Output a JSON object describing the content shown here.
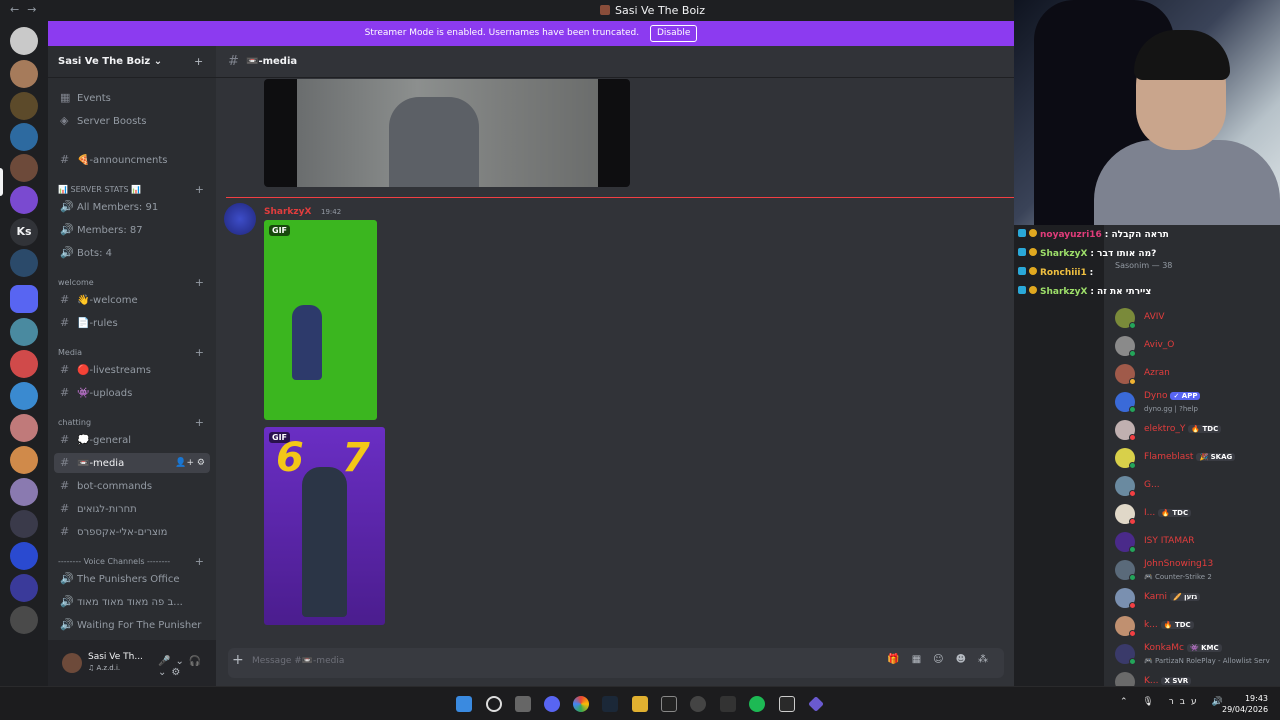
{
  "window": {
    "title": "Sasi Ve The Boiz",
    "nav_back": "←",
    "nav_forward": "→"
  },
  "banner": {
    "text": "Streamer Mode is enabled. Usernames have been truncated.",
    "button": "Disable"
  },
  "server_rail": {
    "ks_label": "Ks"
  },
  "guild": {
    "name": "Sasi Ve The Boiz ⌄",
    "invite_icon": "+"
  },
  "sidebar": {
    "top_items": [
      {
        "label": "Events",
        "icon": "calendar-icon"
      },
      {
        "label": "Server Boosts",
        "icon": "boost-icon"
      }
    ],
    "channels": [
      {
        "label": "🍕-announcments",
        "sym": "#"
      },
      {
        "category": "📊 SERVER STATS 📊",
        "plus": "+"
      },
      {
        "label": "All Members: 91",
        "sym": "🔊"
      },
      {
        "label": "Members: 87",
        "sym": "🔊"
      },
      {
        "label": "Bots: 4",
        "sym": "🔊"
      },
      {
        "category": "welcome",
        "plus": "+"
      },
      {
        "label": "👋-welcome",
        "sym": "#"
      },
      {
        "label": "📄-rules",
        "sym": "#"
      },
      {
        "category": "Media",
        "plus": "+"
      },
      {
        "label": "🔴-livestreams",
        "sym": "#"
      },
      {
        "label": "👾-uploads",
        "sym": "#"
      },
      {
        "category": "chatting",
        "plus": "+"
      },
      {
        "label": "💭-general",
        "sym": "#"
      },
      {
        "label": "📼-media",
        "sym": "#",
        "active": true
      },
      {
        "label": "bot-commands",
        "sym": "#"
      },
      {
        "label": "תחרות-לגואים",
        "sym": "#"
      },
      {
        "label": "מוצרים-אלי-אקספרס",
        "sym": "#"
      },
      {
        "category": "-------- Voice Channels --------",
        "plus": "+"
      },
      {
        "label": "The Punishers Office",
        "sym": "🔊"
      },
      {
        "label": "ב פה מאוד מאוד מאוד...",
        "sym": "🔊"
      },
      {
        "label": "Waiting For The Punisher",
        "sym": "🔊"
      }
    ]
  },
  "userbar": {
    "name": "Sasi Ve Th...",
    "status": "♫ A.z.d.i.",
    "controls": "🎤⌄🎧⌄⚙"
  },
  "channel_header": {
    "hash": "#",
    "name": "📼-media"
  },
  "message": {
    "author": "SharkzyX",
    "time": "19:42",
    "gif_tag": "GIF",
    "gif2_left": "6",
    "gif2_right": "7"
  },
  "composer": {
    "plus": "+",
    "placeholder": "Message #📼-media",
    "tools": "🎁▦☺☻⁂"
  },
  "stream_chat": [
    {
      "user": "noyayuzri16",
      "msg": ": תראה הקבלה",
      "color": "#e03c7a"
    },
    {
      "user": "SharkzyX",
      "msg": ": מה אותו דבר?",
      "color": "#9ee06a"
    },
    {
      "user": "Ronchiii1",
      "msg": ":",
      "color": "#f0c040"
    },
    {
      "user": "SharkzyX",
      "msg": ": ציירתי את זה",
      "color": "#9ee06a"
    }
  ],
  "members": {
    "header": "Sasonim — 38",
    "list": [
      {
        "name": "AVIV",
        "color": "#e23d3d",
        "av": "#7a8a3a",
        "dot": "#23a55a"
      },
      {
        "name": "Aviv_O",
        "color": "#e23d3d",
        "av": "#8a8a8a",
        "dot": "#23a55a"
      },
      {
        "name": "Azran",
        "color": "#e23d3d",
        "av": "#a05a4a",
        "dot": "#f0b232"
      },
      {
        "name": "Dyno",
        "color": "#e23d3d",
        "av": "#3a6ad8",
        "dot": "#23a55a",
        "tag": "✓ APP",
        "sub": "dyno.gg | ?help"
      },
      {
        "name": "elektro_Y",
        "color": "#e23d3d",
        "av": "#c0b0b0",
        "dot": "#f23f43",
        "tag": "🔥 TDC"
      },
      {
        "name": "Flameblast",
        "color": "#e23d3d",
        "av": "#d8d04a",
        "dot": "#23a55a",
        "tag": "🎉 SKAG"
      },
      {
        "name": "G...",
        "color": "#e23d3d",
        "av": "#6a8aa0",
        "dot": "#f23f43"
      },
      {
        "name": "I...",
        "color": "#e23d3d",
        "av": "#e0d8c8",
        "dot": "#f23f43",
        "tag": "🔥 TDC"
      },
      {
        "name": "ISY ITAMAR",
        "color": "#e23d3d",
        "av": "#4a2a8a",
        "dot": "#23a55a"
      },
      {
        "name": "JohnSnowing13",
        "color": "#e23d3d",
        "av": "#5a6a7a",
        "dot": "#23a55a",
        "sub": "🎮 Counter-Strike 2"
      },
      {
        "name": "Karni",
        "color": "#e23d3d",
        "av": "#7a90b0",
        "dot": "#f23f43",
        "tag": "🥖 גזען"
      },
      {
        "name": "k...",
        "color": "#e23d3d",
        "av": "#c09070",
        "dot": "#f23f43",
        "tag": "🔥 TDC"
      },
      {
        "name": "KonkaMc",
        "color": "#e23d3d",
        "av": "#3a3a6a",
        "dot": "#23a55a",
        "tag": "👾 KMC",
        "sub": "🎮 PartizaN RolePlay - Allowlist Serv"
      },
      {
        "name": "K...",
        "color": "#e23d3d",
        "av": "#6a6a6a",
        "dot": "#23a55a",
        "tag": "X SVR"
      }
    ]
  },
  "taskbar": {
    "tray": "⌃ 🎙 עבר 🔊",
    "time": "19:43",
    "date": "29/04/2026"
  }
}
